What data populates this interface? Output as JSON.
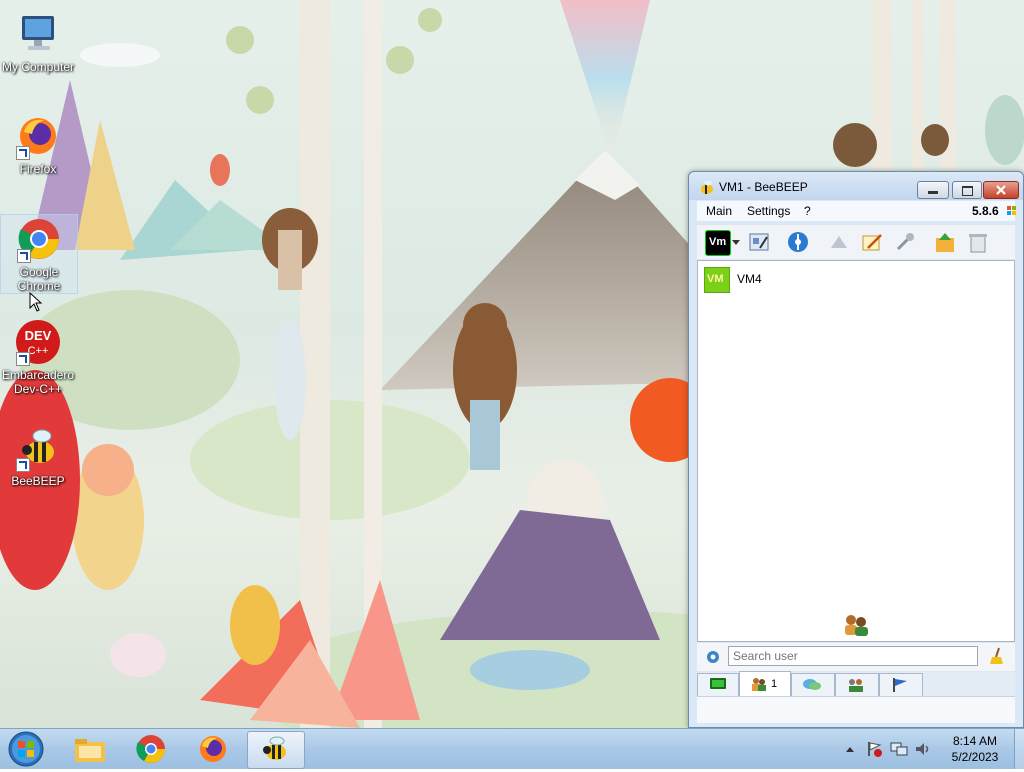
{
  "desktop": {
    "icons": [
      {
        "label": "My Computer"
      },
      {
        "label": "Firefox"
      },
      {
        "label": "Google Chrome"
      },
      {
        "label": "Embarcadero Dev-C++"
      },
      {
        "label": "BeeBEEP"
      }
    ]
  },
  "window": {
    "title": "VM1 - BeeBEEP",
    "menu": [
      "Main",
      "Settings",
      "?"
    ],
    "version": "5.8.6",
    "status_logo": "Vm",
    "users": [
      {
        "badge": "VM",
        "name": "VM4"
      }
    ],
    "search": {
      "placeholder": "Search user"
    },
    "tabs": [
      {
        "icon": "monitor-icon"
      },
      {
        "icon": "users-icon",
        "count": "1"
      },
      {
        "icon": "chat-icon"
      },
      {
        "icon": "group-icon"
      },
      {
        "icon": "flag-icon"
      }
    ]
  },
  "taskbar": {
    "clock_time": "8:14 AM",
    "clock_date": "5/2/2023",
    "apps": [
      "file-explorer-icon",
      "chrome-icon",
      "firefox-icon",
      "beebeep-icon"
    ]
  }
}
